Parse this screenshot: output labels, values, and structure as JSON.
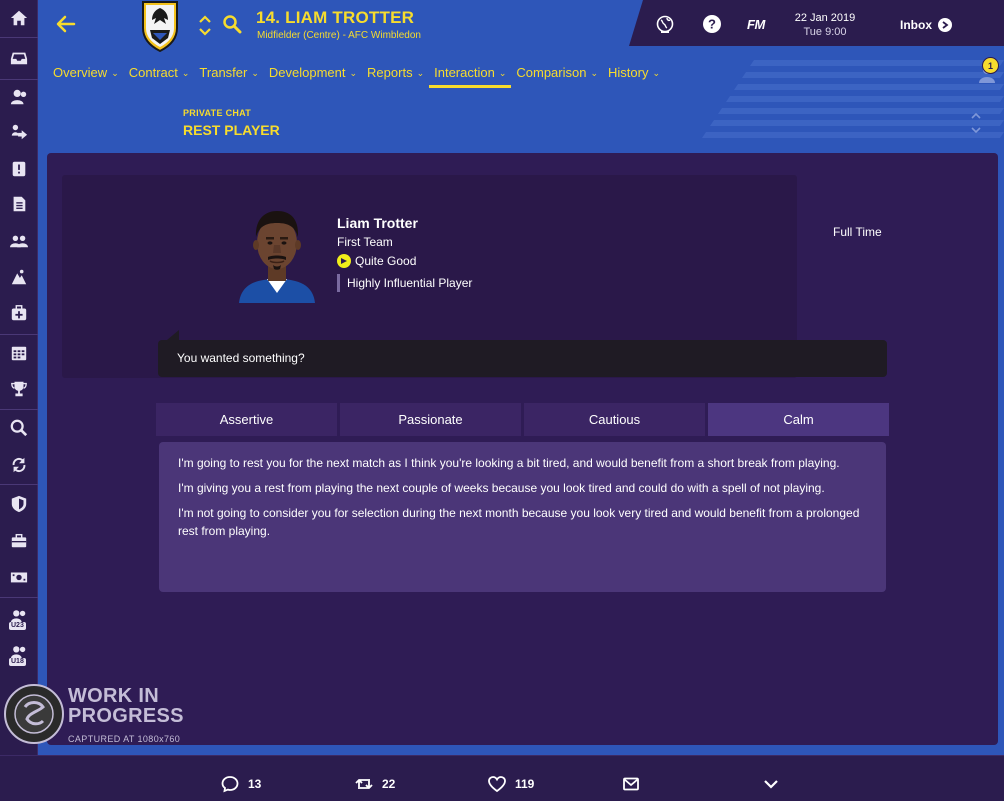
{
  "header": {
    "player_title": "14. LIAM TROTTER",
    "player_subtitle": "Midfielder (Centre) - AFC Wimbledon",
    "fm_label": "FM",
    "date": "22 Jan 2019",
    "time": "Tue 9:00",
    "inbox_label": "Inbox",
    "notification_count": "1"
  },
  "nav": {
    "tabs": [
      {
        "label": "Overview"
      },
      {
        "label": "Contract"
      },
      {
        "label": "Transfer"
      },
      {
        "label": "Development"
      },
      {
        "label": "Reports"
      },
      {
        "label": "Interaction",
        "active": true
      },
      {
        "label": "Comparison"
      },
      {
        "label": "History"
      }
    ]
  },
  "section": {
    "label": "PRIVATE CHAT",
    "title": "REST PLAYER"
  },
  "player": {
    "name": "Liam Trotter",
    "squad": "First Team",
    "rating": "Quite Good",
    "influence": "Highly Influential Player",
    "contract_status": "Full Time"
  },
  "chat": {
    "prompt": "You wanted something?"
  },
  "tones": [
    {
      "label": "Assertive"
    },
    {
      "label": "Passionate"
    },
    {
      "label": "Cautious"
    },
    {
      "label": "Calm",
      "active": true
    }
  ],
  "responses": [
    "I'm going to rest you for the next match as I think you're looking a bit tired, and would benefit from a short break from playing.",
    "I'm giving you a rest from playing the next couple of weeks because you look tired and could do with a spell of not playing.",
    "I'm not going to consider you for selection during the next month because you look very tired and would benefit from a prolonged rest from playing."
  ],
  "watermark": {
    "title_line1": "WORK IN",
    "title_line2": "PROGRESS",
    "caption": "CAPTURED AT 1080x760"
  },
  "sidebar": {
    "u23_tag": "U23",
    "u18_tag": "U18"
  },
  "social": {
    "comments": "13",
    "retweets": "22",
    "likes": "119"
  },
  "colors": {
    "accent_yellow": "#f7dc2d",
    "header_blue": "#2e56b9",
    "panel_purple": "#2f1c55"
  }
}
